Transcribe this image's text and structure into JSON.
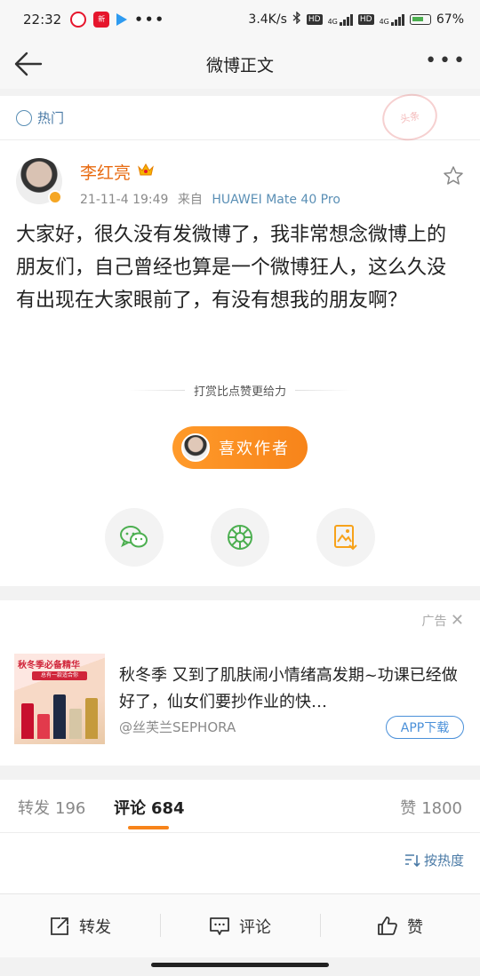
{
  "status_bar": {
    "time": "22:32",
    "news_app_label": "新",
    "speed": "3.4K/s",
    "hd1": "HD",
    "hd2": "HD",
    "net1": "4G",
    "net2": "4G",
    "battery": "67%"
  },
  "nav": {
    "title": "微博正文"
  },
  "hot": {
    "label": "热门",
    "stamp_text": "头条"
  },
  "post": {
    "author": "李红亮",
    "date": "21-11-4 19:49",
    "from_label": "来自",
    "device": "HUAWEI Mate 40 Pro",
    "text": "大家好，很久没有发微博了，我非常想念微博上的朋友们，自己曾经也算是一个微博狂人，这么久没有出现在大家眼前了，有没有想我的朋友啊？",
    "reward_prompt": "打赏比点赞更给力",
    "like_author_label": "喜欢作者"
  },
  "ad": {
    "tag": "广告",
    "image_headline": "秋冬季必备精华",
    "image_subline": "总有一款适合你",
    "text": "秋冬季 又到了肌肤闹小情绪高发期~功课已经做好了，仙女们要抄作业的快…",
    "source": "@丝芙兰SEPHORA",
    "download_label": "APP下载"
  },
  "tabs": {
    "repost_label": "转发",
    "repost_count": "196",
    "comment_label": "评论",
    "comment_count": "684",
    "like_label": "赞",
    "like_count": "1800"
  },
  "sort": {
    "label": "按热度"
  },
  "bottom_bar": {
    "repost": "转发",
    "comment": "评论",
    "like": "赞"
  },
  "colors": {
    "accent": "#f7841a",
    "link": "#4a7aa6",
    "author": "#e86b12"
  }
}
